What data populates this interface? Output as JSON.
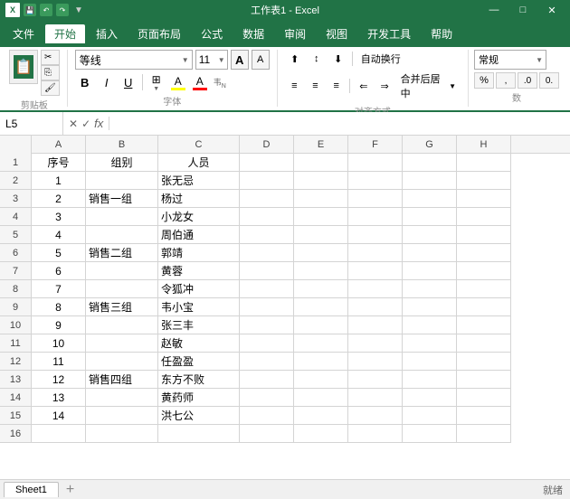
{
  "titlebar": {
    "title": "工作表1 - Excel",
    "save_label": "💾",
    "undo_label": "↶",
    "redo_label": "↷"
  },
  "menubar": {
    "items": [
      "文件",
      "开始",
      "插入",
      "页面布局",
      "公式",
      "数据",
      "审阅",
      "视图",
      "开发工具",
      "帮助"
    ],
    "active": "开始"
  },
  "ribbon": {
    "font_name": "等线",
    "font_size": "11",
    "bold": "B",
    "italic": "I",
    "underline": "U",
    "wrap_text": "自动换行",
    "merge_center": "合并后居中",
    "number_format": "常规",
    "font_label": "字体",
    "align_label": "对齐方式",
    "number_label": "数"
  },
  "formula_bar": {
    "cell_ref": "L5",
    "formula": ""
  },
  "columns": {
    "widths": [
      35,
      60,
      80,
      90,
      60,
      60,
      60,
      60,
      60
    ],
    "labels": [
      "",
      "A",
      "B",
      "C",
      "D",
      "E",
      "F",
      "G",
      "H"
    ]
  },
  "rows": [
    {
      "num": 1,
      "cells": [
        "序号",
        "组别",
        "人员",
        "",
        "",
        "",
        "",
        ""
      ]
    },
    {
      "num": 2,
      "cells": [
        "1",
        "",
        "张无忌",
        "",
        "",
        "",
        "",
        ""
      ]
    },
    {
      "num": 3,
      "cells": [
        "2",
        "销售一组",
        "杨过",
        "",
        "",
        "",
        "",
        ""
      ]
    },
    {
      "num": 4,
      "cells": [
        "3",
        "",
        "小龙女",
        "",
        "",
        "",
        "",
        ""
      ]
    },
    {
      "num": 5,
      "cells": [
        "4",
        "",
        "周伯通",
        "",
        "",
        "",
        "",
        ""
      ]
    },
    {
      "num": 6,
      "cells": [
        "5",
        "销售二组",
        "郭靖",
        "",
        "",
        "",
        "",
        ""
      ]
    },
    {
      "num": 7,
      "cells": [
        "6",
        "",
        "黄蓉",
        "",
        "",
        "",
        "",
        ""
      ]
    },
    {
      "num": 8,
      "cells": [
        "7",
        "",
        "令狐冲",
        "",
        "",
        "",
        "",
        ""
      ]
    },
    {
      "num": 9,
      "cells": [
        "8",
        "销售三组",
        "韦小宝",
        "",
        "",
        "",
        "",
        ""
      ]
    },
    {
      "num": 10,
      "cells": [
        "9",
        "",
        "张三丰",
        "",
        "",
        "",
        "",
        ""
      ]
    },
    {
      "num": 11,
      "cells": [
        "10",
        "",
        "赵敏",
        "",
        "",
        "",
        "",
        ""
      ]
    },
    {
      "num": 12,
      "cells": [
        "11",
        "",
        "任盈盈",
        "",
        "",
        "",
        "",
        ""
      ]
    },
    {
      "num": 13,
      "cells": [
        "12",
        "销售四组",
        "东方不败",
        "",
        "",
        "",
        "",
        ""
      ]
    },
    {
      "num": 14,
      "cells": [
        "13",
        "",
        "黄药师",
        "",
        "",
        "",
        "",
        ""
      ]
    },
    {
      "num": 15,
      "cells": [
        "14",
        "",
        "洪七公",
        "",
        "",
        "",
        "",
        ""
      ]
    },
    {
      "num": 16,
      "cells": [
        "",
        "",
        "",
        "",
        "",
        "",
        "",
        ""
      ]
    }
  ],
  "sheet_tabs": [
    "Sheet1"
  ],
  "active_tab": "Sheet1",
  "status": "就绪"
}
